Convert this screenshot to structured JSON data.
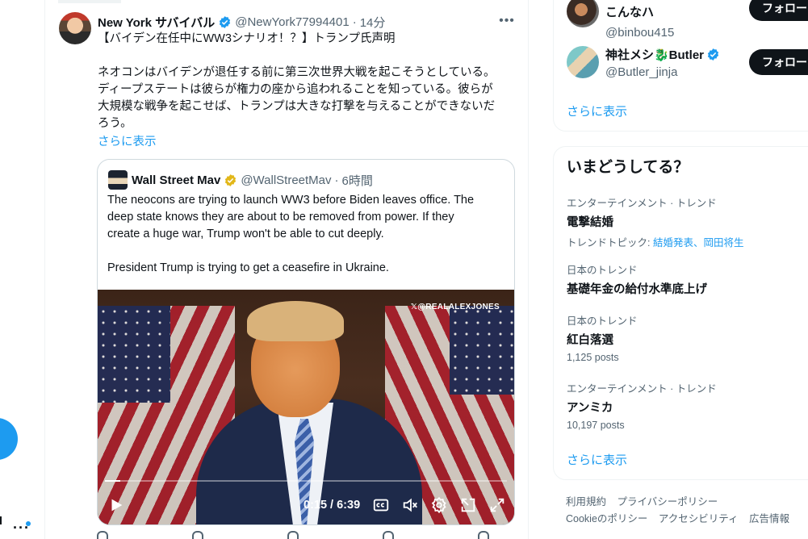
{
  "tweet": {
    "author_name": "New York サバイバル",
    "handle": "@NewYork77994401",
    "separator": "·",
    "time": "14分",
    "text": "【バイデン在任中にWW3シナリオ！？】トランプ氏声明\n\nネオコンはバイデンが退任する前に第三次世界大戦を起こそうとしている。\nディープステートは彼らが権力の座から追われることを知っている。彼らが\n大規模な戦争を起こせば、トランプは大きな打撃を与えることができないだ\nろう。",
    "show_more": "さらに表示",
    "more_icon": "more-horizontal-icon"
  },
  "quote": {
    "author_name": "Wall Street Mav",
    "handle": "@WallStreetMav",
    "separator": "·",
    "time": "6時間",
    "text": "The neocons are trying to launch WW3 before Biden leaves office. The\ndeep state knows they are about to be removed from power. If they\ncreate a huge war, Trump won't be able to cut deeply.\n\nPresident Trump is trying to get a ceasefire in Ukraine.",
    "video": {
      "watermark": "𝕏@REALALEXJONES",
      "time_readout": "0:15 / 6:39",
      "progress": 0.038
    }
  },
  "follow_suggestions": [
    {
      "name": "こんなハ",
      "handle": "@binbou415",
      "button": "フォロー"
    },
    {
      "name": "神社メシ🐉Butler",
      "handle": "@Butler_jinja",
      "button": "フォロー"
    }
  ],
  "follow_show_more": "さらに表示",
  "trends": {
    "title": "いまどうしてる？",
    "items": [
      {
        "context": "エンターテインメント · トレンド",
        "name": "電撃結婚",
        "extra_label": "トレンドトピック: ",
        "extra_links": "結婚発表、岡田将生"
      },
      {
        "context": "日本のトレンド",
        "name": "基礎年金の給付水準底上げ"
      },
      {
        "context": "日本のトレンド",
        "name": "紅白落選",
        "posts": "1,125 posts"
      },
      {
        "context": "エンターテインメント · トレンド",
        "name": "アンミカ",
        "posts": "10,197 posts"
      }
    ],
    "show_more": "さらに表示"
  },
  "footer": {
    "links": [
      "利用規約",
      "プライバシーポリシー",
      "Cookieのポリシー",
      "アクセシビリティ",
      "広告情報"
    ]
  },
  "colors": {
    "accent": "#1d9bf0",
    "text": "#0f1419",
    "secondary": "#536471",
    "button_bg": "#0f1419"
  }
}
